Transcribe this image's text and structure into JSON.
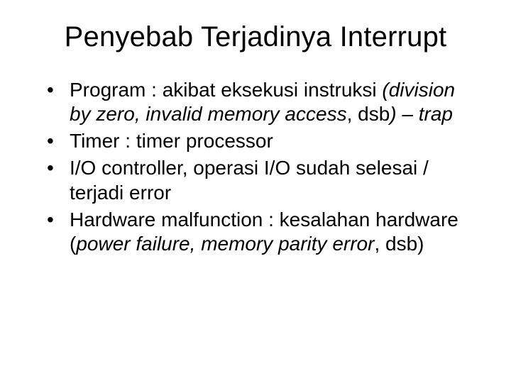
{
  "title": "Penyebab Terjadinya Interrupt",
  "bullets": [
    {
      "pre": "Program : akibat eksekusi instruksi ",
      "italic1": "(division by zero, invalid memory access",
      "mid1": ", dsb",
      "italic2": ") – trap",
      "post": ""
    },
    {
      "pre": "Timer : timer processor",
      "italic1": "",
      "mid1": "",
      "italic2": "",
      "post": ""
    },
    {
      "pre": "I/O controller, operasi I/O sudah selesai / terjadi error",
      "italic1": "",
      "mid1": "",
      "italic2": "",
      "post": ""
    },
    {
      "pre": "Hardware malfunction : kesalahan hardware (",
      "italic1": "power failure, memory parity error",
      "mid1": ", dsb)",
      "italic2": "",
      "post": ""
    }
  ]
}
